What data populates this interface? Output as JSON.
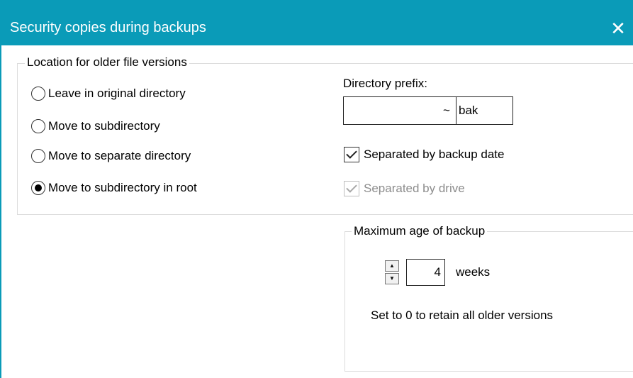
{
  "window": {
    "title": "Security copies during backups",
    "close_symbol": "✕",
    "accent_color": "#0a9bb8"
  },
  "location_group": {
    "legend": "Location for older file versions",
    "options": [
      {
        "label": "Leave in original directory",
        "checked": false
      },
      {
        "label": "Move to subdirectory",
        "checked": false
      },
      {
        "label": "Move to separate directory",
        "checked": false
      },
      {
        "label": "Move to subdirectory in root",
        "checked": true
      }
    ]
  },
  "prefix": {
    "label": "Directory prefix:",
    "value": "",
    "tilde": "~",
    "suffix": "bak"
  },
  "checkboxes": {
    "by_date": {
      "label": "Separated by backup date",
      "checked": true,
      "enabled": true
    },
    "by_drive": {
      "label": "Separated by drive",
      "checked": true,
      "enabled": false
    }
  },
  "age_group": {
    "legend": "Maximum age of backup",
    "value": "4",
    "unit": "weeks",
    "note": "Set to 0 to retain all older versions",
    "spin_up_icon": "▲",
    "spin_down_icon": "▼"
  }
}
